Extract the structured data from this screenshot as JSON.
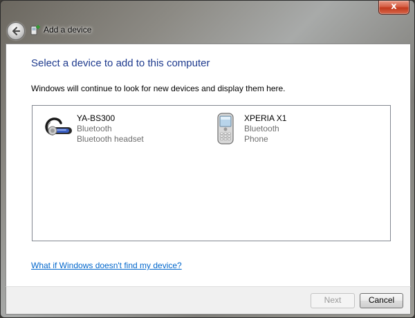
{
  "window": {
    "title": "Add a device",
    "close_label": "x"
  },
  "main": {
    "heading": "Select a device to add to this computer",
    "subtext": "Windows will continue to look for new devices and display them here.",
    "devices": [
      {
        "name": "YA-BS300",
        "type": "Bluetooth",
        "subtype": "Bluetooth headset",
        "icon": "headset-icon"
      },
      {
        "name": "XPERIA X1",
        "type": "Bluetooth",
        "subtype": "Phone",
        "icon": "phone-icon"
      }
    ],
    "help_link": "What if Windows doesn't find my device?"
  },
  "footer": {
    "next_label": "Next",
    "cancel_label": "Cancel"
  }
}
